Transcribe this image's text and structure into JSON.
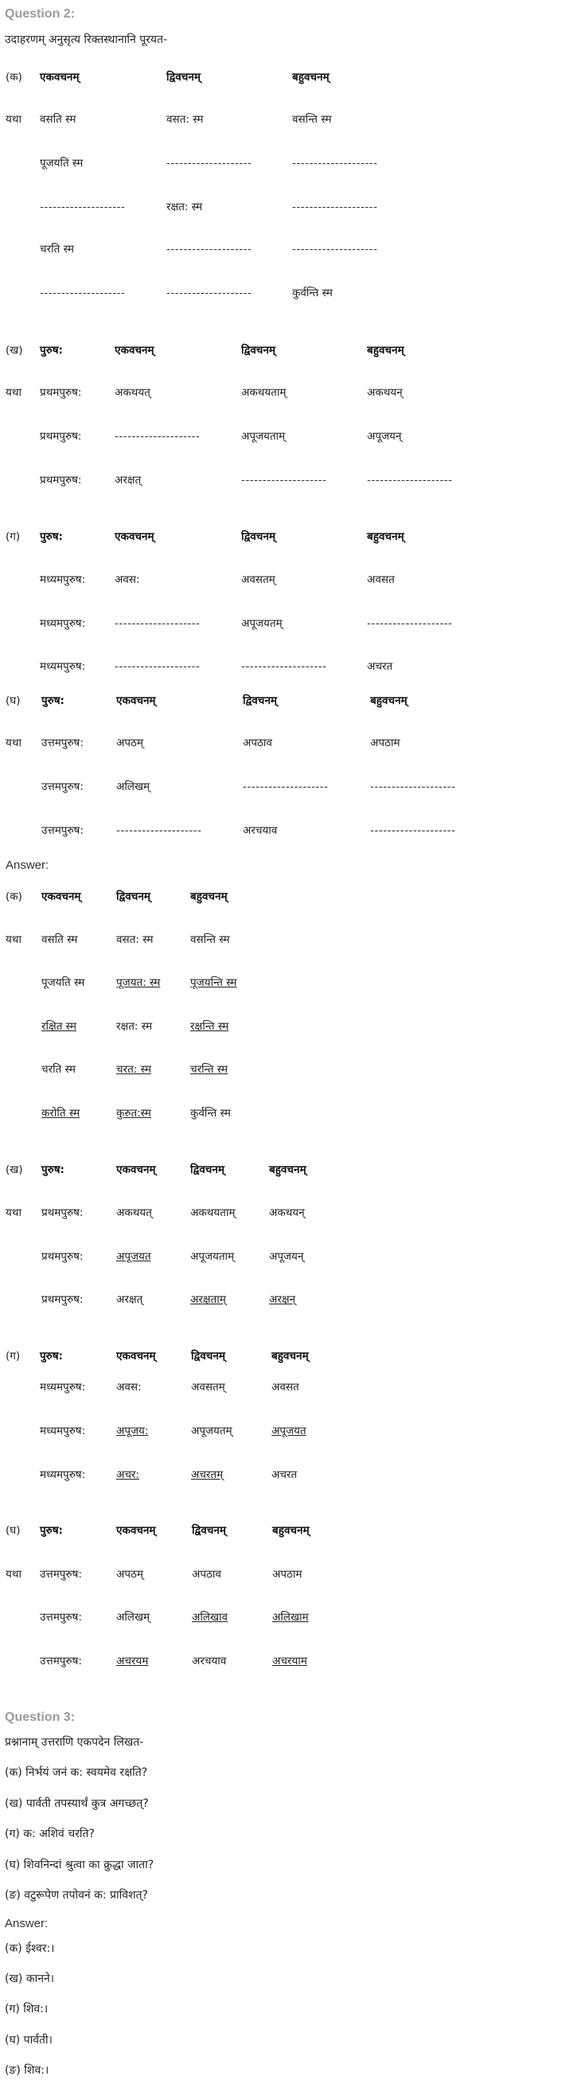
{
  "question2": {
    "heading": "Question 2:",
    "instruction": "उदाहरणम् अनुसृत्य रिक्तस्थानानि पूरयत-",
    "tables": [
      {
        "rows": [
          [
            {
              "t": "(क)"
            },
            {
              "t": "एकवचनम्",
              "b": 1
            },
            {
              "t": "द्विवचनम्",
              "b": 1
            },
            {
              "t": "बहुवचनम्",
              "b": 1
            }
          ],
          [
            {
              "t": "यथा"
            },
            {
              "t": "वसति स्म"
            },
            {
              "t": "वसत: स्म"
            },
            {
              "t": "वसन्ति स्म"
            }
          ],
          [
            {
              "t": ""
            },
            {
              "t": "पूजयति स्म"
            },
            {
              "t": "--------------------",
              "d": 1
            },
            {
              "t": "--------------------",
              "d": 1
            }
          ],
          [
            {
              "t": ""
            },
            {
              "t": "--------------------",
              "d": 1
            },
            {
              "t": "रक्षत: स्म"
            },
            {
              "t": "--------------------",
              "d": 1
            }
          ],
          [
            {
              "t": ""
            },
            {
              "t": "चरति स्म"
            },
            {
              "t": "--------------------",
              "d": 1
            },
            {
              "t": "--------------------",
              "d": 1
            }
          ],
          [
            {
              "t": ""
            },
            {
              "t": "--------------------",
              "d": 1
            },
            {
              "t": "--------------------",
              "d": 1
            },
            {
              "t": "कुर्वन्ति स्म"
            }
          ]
        ]
      },
      {
        "rows": [
          [
            {
              "t": "(ख)"
            },
            {
              "t": "पुरुष:",
              "b": 1
            },
            {
              "t": "एकवचनम्",
              "b": 1
            },
            {
              "t": "द्विवचनम्",
              "b": 1
            },
            {
              "t": "बहुवचनम्",
              "b": 1
            }
          ],
          [
            {
              "t": "यथा"
            },
            {
              "t": "प्रथमपुरुष:"
            },
            {
              "t": "अकथयत्"
            },
            {
              "t": "अकथयताम्"
            },
            {
              "t": "अकथयन्"
            }
          ],
          [
            {
              "t": ""
            },
            {
              "t": "प्रथमपुरुष:"
            },
            {
              "t": "--------------------",
              "d": 1
            },
            {
              "t": "अपूजयताम्"
            },
            {
              "t": "अपूजयन्"
            }
          ],
          [
            {
              "t": ""
            },
            {
              "t": "प्रथमपुरुष:"
            },
            {
              "t": "अरक्षत्"
            },
            {
              "t": "--------------------",
              "d": 1
            },
            {
              "t": "--------------------",
              "d": 1
            }
          ]
        ]
      },
      {
        "rows": [
          [
            {
              "t": "(ग)"
            },
            {
              "t": "पुरुष:",
              "b": 1
            },
            {
              "t": "एकवचनम्",
              "b": 1
            },
            {
              "t": "द्विवचनम्",
              "b": 1
            },
            {
              "t": "बहुवचनम्",
              "b": 1
            }
          ],
          [
            {
              "t": ""
            },
            {
              "t": "मध्यमपुरुष:"
            },
            {
              "t": "अवस:"
            },
            {
              "t": "अवसतम्"
            },
            {
              "t": "अवसत"
            }
          ],
          [
            {
              "t": ""
            },
            {
              "t": "मध्यमपुरुष:"
            },
            {
              "t": "--------------------",
              "d": 1
            },
            {
              "t": "अपूजयतम्"
            },
            {
              "t": "--------------------",
              "d": 1
            }
          ],
          [
            {
              "t": ""
            },
            {
              "t": "मध्यमपुरुष:"
            },
            {
              "t": "--------------------",
              "d": 1
            },
            {
              "t": "--------------------",
              "d": 1
            },
            {
              "t": "अचरत"
            }
          ]
        ]
      },
      {
        "rows": [
          [
            {
              "t": "(घ)"
            },
            {
              "t": "पुरुष:",
              "b": 1
            },
            {
              "t": "एकवचनम्",
              "b": 1
            },
            {
              "t": "द्विवचनम्",
              "b": 1
            },
            {
              "t": "बहुवचनम्",
              "b": 1
            }
          ],
          [
            {
              "t": "यथा"
            },
            {
              "t": "उत्तमपुरुष:"
            },
            {
              "t": "अपठम्"
            },
            {
              "t": "अपठाव"
            },
            {
              "t": "अपठाम"
            }
          ],
          [
            {
              "t": ""
            },
            {
              "t": "उत्तमपुरुष:"
            },
            {
              "t": "अलिखम्"
            },
            {
              "t": "--------------------",
              "d": 1
            },
            {
              "t": "--------------------",
              "d": 1
            }
          ],
          [
            {
              "t": ""
            },
            {
              "t": "उत्तमपुरुष:"
            },
            {
              "t": "--------------------",
              "d": 1
            },
            {
              "t": "अरचयाव"
            },
            {
              "t": "--------------------",
              "d": 1
            }
          ]
        ]
      }
    ],
    "answer_label": "Answer:",
    "answer_tables": [
      {
        "rows": [
          [
            {
              "t": "(क)"
            },
            {
              "t": "एकवचनम्",
              "b": 1
            },
            {
              "t": "द्विवचनम्",
              "b": 1
            },
            {
              "t": "बहुवचनम्",
              "b": 1
            }
          ],
          [
            {
              "t": "यथा"
            },
            {
              "t": "वसति स्म"
            },
            {
              "t": "वसत: स्म"
            },
            {
              "t": "वसन्ति स्म"
            }
          ],
          [
            {
              "t": ""
            },
            {
              "t": "पूजयति स्म"
            },
            {
              "t": "पूजयत: स्म",
              "u": 1
            },
            {
              "t": "पूजयन्ति स्म",
              "u": 1
            }
          ],
          [
            {
              "t": ""
            },
            {
              "t": "रक्षित स्म",
              "u": 1
            },
            {
              "t": "रक्षत: स्म"
            },
            {
              "t": "रक्षन्ति स्म",
              "u": 1
            }
          ],
          [
            {
              "t": ""
            },
            {
              "t": "चरति स्म"
            },
            {
              "t": "चरत: स्म",
              "u": 1
            },
            {
              "t": "चरन्ति स्म",
              "u": 1
            }
          ],
          [
            {
              "t": ""
            },
            {
              "t": "करोति स्म",
              "u": 1
            },
            {
              "t": "कुरुत:स्म",
              "u": 1
            },
            {
              "t": "कुर्वन्ति स्म"
            }
          ]
        ]
      },
      {
        "rows": [
          [
            {
              "t": "(ख)"
            },
            {
              "t": "पुरुष:",
              "b": 1
            },
            {
              "t": "एकवचनम्",
              "b": 1
            },
            {
              "t": "द्विवचनम्",
              "b": 1
            },
            {
              "t": "बहुवचनम्",
              "b": 1
            }
          ],
          [
            {
              "t": "यथा"
            },
            {
              "t": "प्रथमपुरुष:"
            },
            {
              "t": "अकथयत्"
            },
            {
              "t": "अकथयताम्"
            },
            {
              "t": "अकथयन्"
            }
          ],
          [
            {
              "t": ""
            },
            {
              "t": "प्रथमपुरुष:"
            },
            {
              "t": "अपूजयत",
              "u": 1
            },
            {
              "t": "अपूजयताम्"
            },
            {
              "t": "अपूजयन्"
            }
          ],
          [
            {
              "t": ""
            },
            {
              "t": "प्रथमपुरुष:"
            },
            {
              "t": "अरक्षत्"
            },
            {
              "t": "अरक्षताम्",
              "u": 1
            },
            {
              "t": "अरक्षन्",
              "u": 1
            }
          ]
        ]
      },
      {
        "rows": [
          [
            {
              "t": "(ग)"
            },
            {
              "t": "पुरुष:",
              "b": 1
            },
            {
              "t": "एकवचनम्",
              "b": 1
            },
            {
              "t": "द्विवचनम्",
              "b": 1
            },
            {
              "t": "बहुवचनम्",
              "b": 1
            }
          ],
          [
            {
              "t": ""
            },
            {
              "t": "मध्यमपुरुष:"
            },
            {
              "t": "अवस:"
            },
            {
              "t": "अवसतम्"
            },
            {
              "t": "अवसत"
            }
          ],
          [
            {
              "t": ""
            },
            {
              "t": "मध्यमपुरुष:"
            },
            {
              "t": "अपूजय:",
              "u": 1
            },
            {
              "t": "अपूजयतम्"
            },
            {
              "t": "अपूजयत",
              "u": 1
            }
          ],
          [
            {
              "t": ""
            },
            {
              "t": "मध्यमपुरुष:"
            },
            {
              "t": "अचर:",
              "u": 1
            },
            {
              "t": "अचरतम्",
              "u": 1
            },
            {
              "t": "अचरत"
            }
          ]
        ]
      },
      {
        "rows": [
          [
            {
              "t": "(घ)"
            },
            {
              "t": "पुरुष:",
              "b": 1
            },
            {
              "t": "एकवचनम्",
              "b": 1
            },
            {
              "t": "द्विवचनम्",
              "b": 1
            },
            {
              "t": "बहुवचनम्",
              "b": 1
            }
          ],
          [
            {
              "t": "यथा"
            },
            {
              "t": "उत्तमपुरुष:"
            },
            {
              "t": "अपठम्"
            },
            {
              "t": "अपठाव"
            },
            {
              "t": "अपठाम"
            }
          ],
          [
            {
              "t": ""
            },
            {
              "t": "उत्तमपुरुष:"
            },
            {
              "t": "अलिखम्"
            },
            {
              "t": "अलिखाव",
              "u": 1
            },
            {
              "t": "अलिखाम",
              "u": 1
            }
          ],
          [
            {
              "t": ""
            },
            {
              "t": "उत्तमपुरुष:"
            },
            {
              "t": "अचरयम",
              "u": 1
            },
            {
              "t": "अरचयाव"
            },
            {
              "t": "अचरयाम",
              "u": 1
            }
          ]
        ]
      }
    ]
  },
  "question3": {
    "heading": "Question 3:",
    "instruction": "प्रश्नानाम् उत्तराणि एकपदेन लिखत-",
    "questions": [
      "(क) निर्भयं जनं क: स्वयमेव रक्षति?",
      "(ख) पार्वती तपस्यार्थं कुत्र अगच्छत्?",
      "(ग) क: अशिवं चरति?",
      "(घ) शिवनिन्दां श्रुत्वा का क्रुद्धा जाता?",
      "(ङ) वटुरूपेण तपोवनं क: प्राविशत्?"
    ],
    "answer_label": "Answer:",
    "answers": [
      " (क) ईश्वर:।",
      "(ख) कानने।",
      "(ग) शिव:।",
      "(घ) पार्वती।",
      "(ङ) शिव:।"
    ]
  }
}
